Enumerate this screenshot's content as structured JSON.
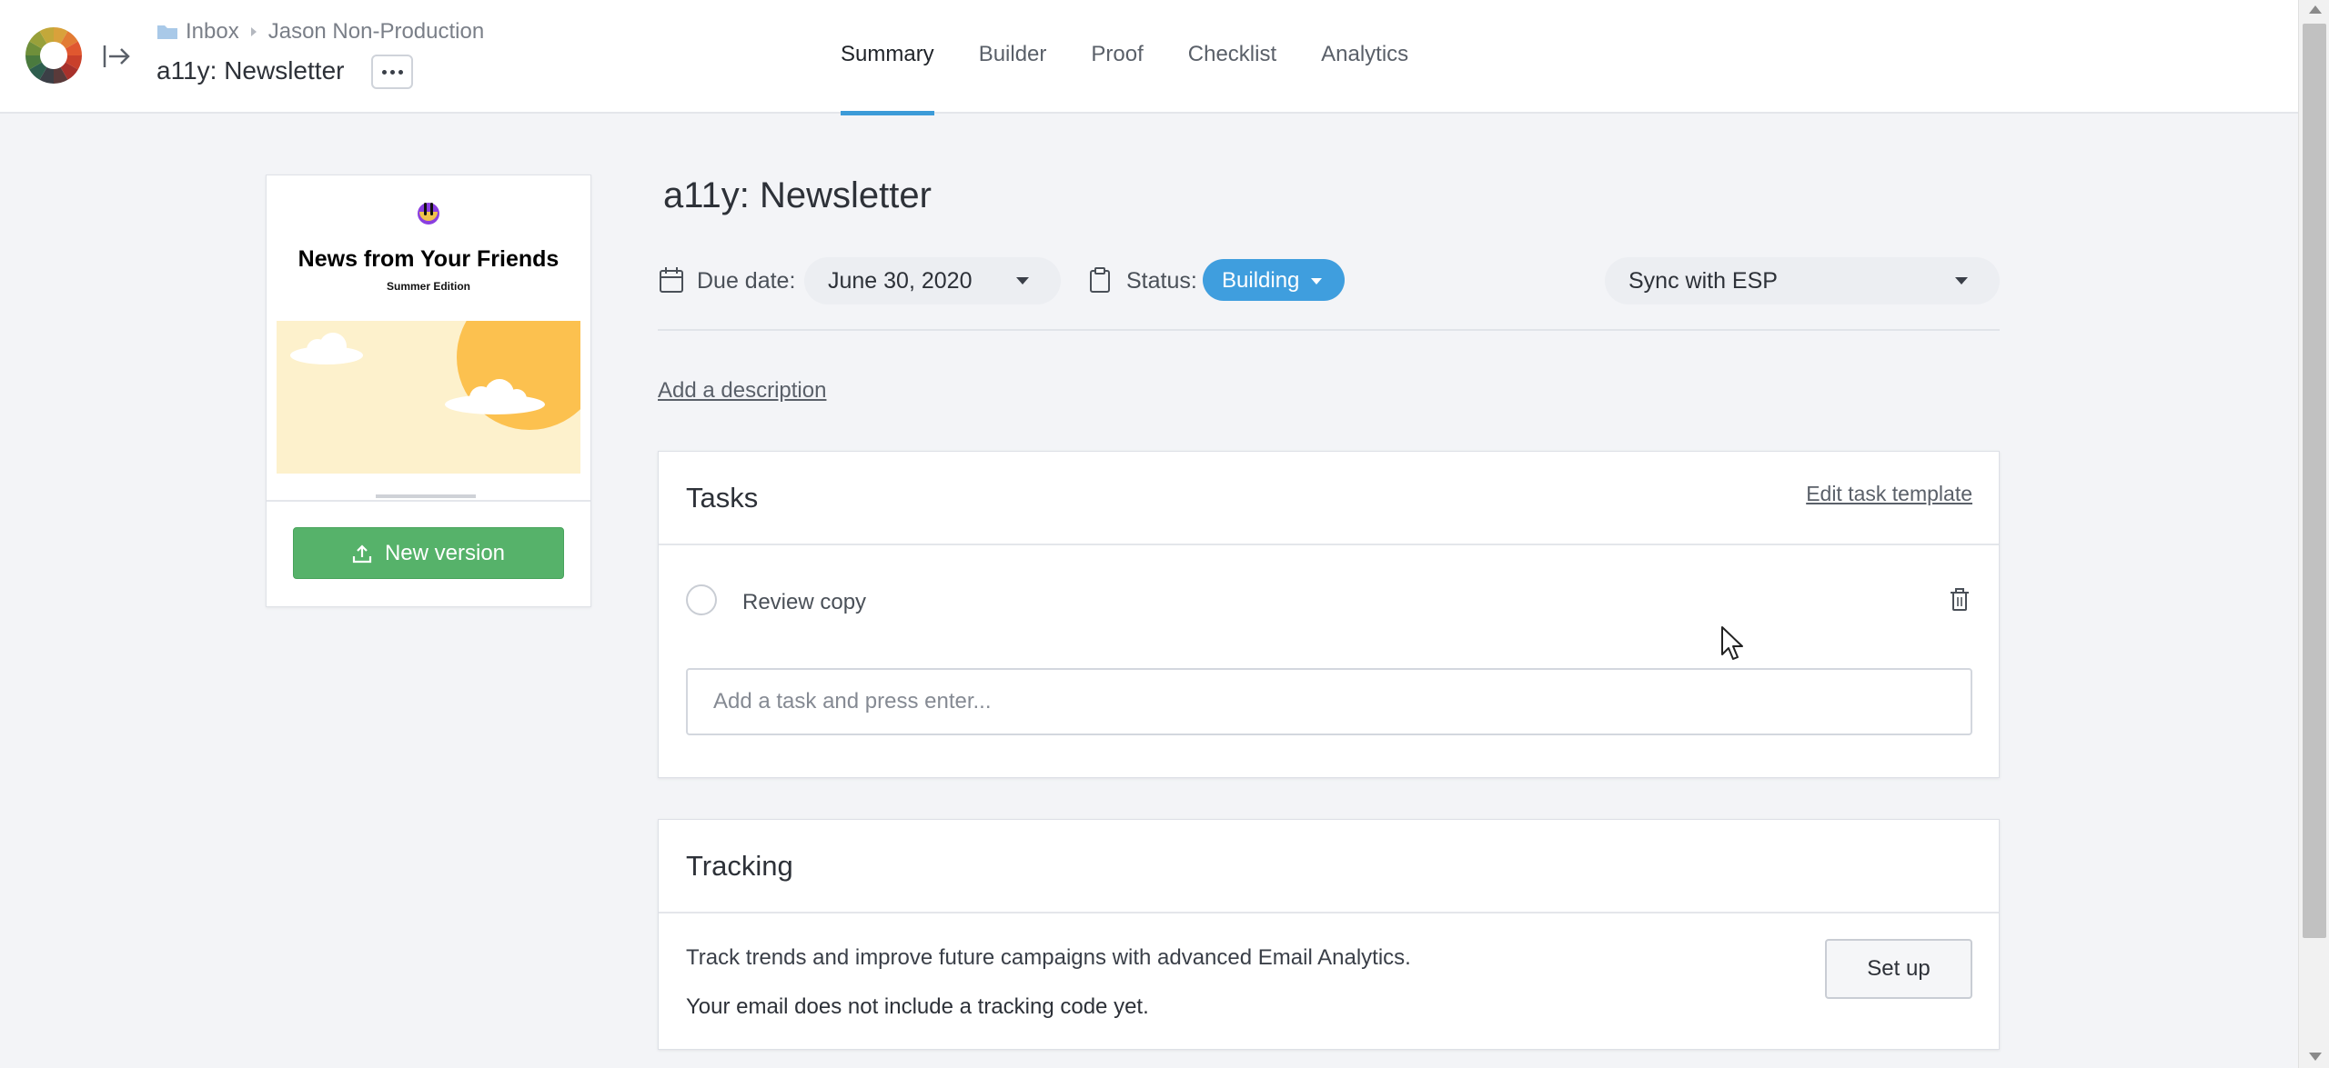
{
  "header": {
    "breadcrumb": [
      "Inbox",
      "Jason Non-Production"
    ],
    "doc_title": "a11y: Newsletter",
    "tabs": [
      "Summary",
      "Builder",
      "Proof",
      "Checklist",
      "Analytics"
    ],
    "active_tab": "Summary"
  },
  "preview": {
    "headline": "News from Your Friends",
    "subheadline": "Summer Edition",
    "new_version_label": "New version"
  },
  "main": {
    "title": "a11y: Newsletter",
    "due_label": "Due date:",
    "due_value": "June 30, 2020",
    "status_label": "Status:",
    "status_value": "Building",
    "status_color": "#3f9ede",
    "sync_value": "Sync with ESP",
    "add_description": "Add a description"
  },
  "tasks": {
    "title": "Tasks",
    "edit_template": "Edit task template",
    "items": [
      {
        "label": "Review copy",
        "done": false
      }
    ],
    "add_placeholder": "Add a task and press enter..."
  },
  "tracking": {
    "title": "Tracking",
    "description": "Track trends and improve future campaigns with advanced Email Analytics.",
    "warning": "Your email does not include a tracking code yet.",
    "setup_label": "Set up"
  },
  "colors": {
    "accent": "#3c9bd8",
    "primary_button": "#56b26a",
    "background": "#f3f4f7"
  }
}
